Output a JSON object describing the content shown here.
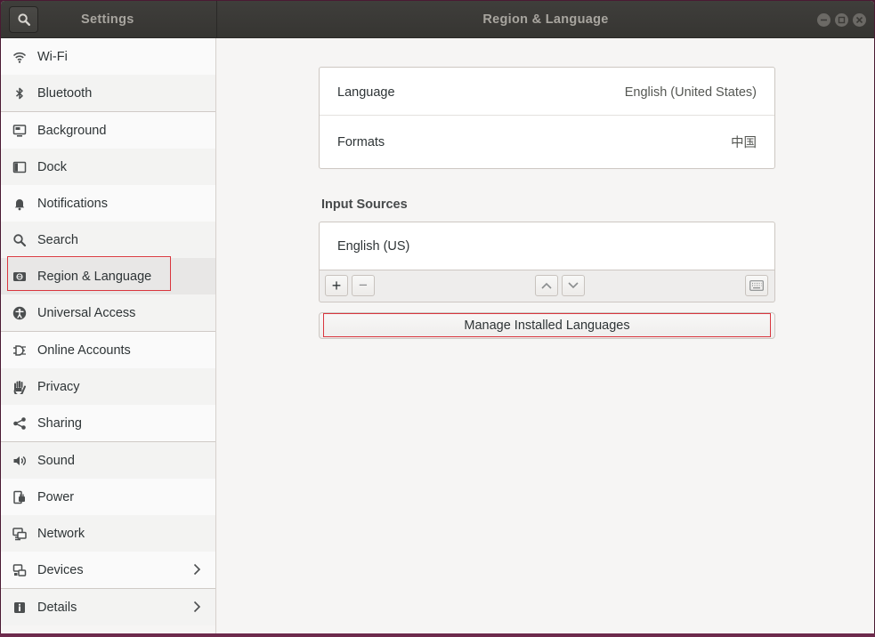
{
  "header": {
    "sidebar_title": "Settings",
    "title": "Region & Language",
    "search_icon": "search-icon",
    "controls": [
      "minimize-icon",
      "maximize-icon",
      "close-icon"
    ]
  },
  "sidebar": {
    "items": [
      {
        "label": "Wi-Fi",
        "icon": "wifi-icon"
      },
      {
        "label": "Bluetooth",
        "icon": "bluetooth-icon"
      },
      {
        "label": "Background",
        "icon": "background-icon"
      },
      {
        "label": "Dock",
        "icon": "dock-icon"
      },
      {
        "label": "Notifications",
        "icon": "bell-icon"
      },
      {
        "label": "Search",
        "icon": "search-icon"
      },
      {
        "label": "Region & Language",
        "icon": "region-icon"
      },
      {
        "label": "Universal Access",
        "icon": "accessibility-icon"
      },
      {
        "label": "Online Accounts",
        "icon": "online-accounts-icon"
      },
      {
        "label": "Privacy",
        "icon": "hand-icon"
      },
      {
        "label": "Sharing",
        "icon": "share-icon"
      },
      {
        "label": "Sound",
        "icon": "speaker-icon"
      },
      {
        "label": "Power",
        "icon": "power-plug-icon"
      },
      {
        "label": "Network",
        "icon": "network-icon"
      },
      {
        "label": "Devices",
        "icon": "devices-icon"
      },
      {
        "label": "Details",
        "icon": "info-icon"
      }
    ]
  },
  "main": {
    "language_label": "Language",
    "language_value": "English (United States)",
    "formats_label": "Formats",
    "formats_value": "中国",
    "input_sources_title": "Input Sources",
    "input_source": "English (US)",
    "add_label": "+",
    "remove_label": "−",
    "manage_label": "Manage Installed Languages"
  }
}
